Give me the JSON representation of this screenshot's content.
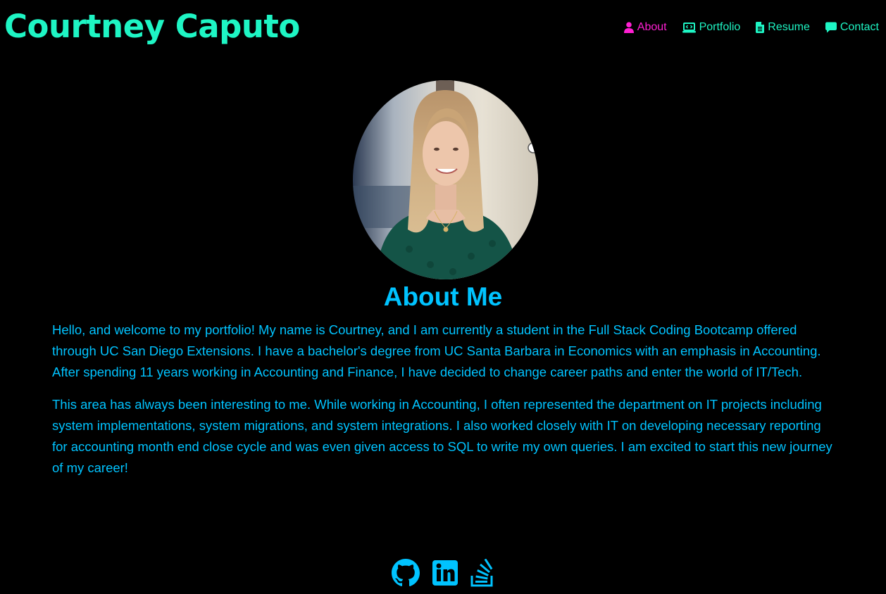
{
  "header": {
    "title": "Courtney Caputo",
    "nav": [
      {
        "label": "About",
        "icon": "user-icon",
        "active": true
      },
      {
        "label": "Portfolio",
        "icon": "laptop-code-icon",
        "active": false
      },
      {
        "label": "Resume",
        "icon": "file-icon",
        "active": false
      },
      {
        "label": "Contact",
        "icon": "comment-icon",
        "active": false
      }
    ]
  },
  "about": {
    "heading": "About Me",
    "paragraphs": [
      "Hello, and welcome to my portfolio! My name is Courtney, and I am currently a student in the Full Stack Coding Bootcamp offered through UC San Diego Extensions. I have a bachelor's degree from UC Santa Barbara in Economics with an emphasis in Accounting. After spending 11 years working in Accounting and Finance, I have decided to change career paths and enter the world of IT/Tech.",
      "This area has always been interesting to me. While working in Accounting, I often represented the department on IT projects including system implementations, system migrations, and system integrations. I also worked closely with IT on developing necessary reporting for accounting month end close cycle and was even given access to SQL to write my own queries. I am excited to start this new journey of my career!"
    ]
  },
  "footer": {
    "socials": [
      {
        "icon": "github-icon"
      },
      {
        "icon": "linkedin-icon"
      },
      {
        "icon": "stack-overflow-icon"
      }
    ]
  },
  "colors": {
    "background": "#000000",
    "title": "#1ef5c4",
    "nav": "#1ef5c4",
    "nav_active": "#ff1fd2",
    "text": "#00c3ff"
  }
}
